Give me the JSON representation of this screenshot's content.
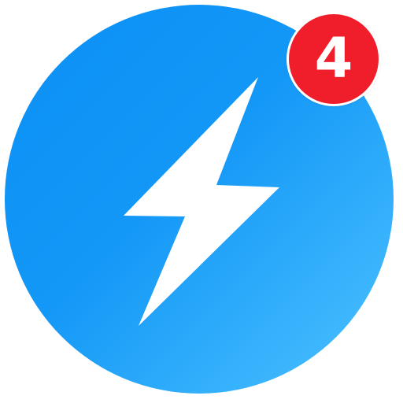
{
  "app_icon": {
    "icon": "lightning-bolt-icon",
    "gradient_start": "#0a8ff5",
    "gradient_end": "#45bcff",
    "bolt_color": "#ffffff"
  },
  "badge": {
    "count": "4",
    "color": "#f01e2a",
    "text_color": "#ffffff"
  }
}
